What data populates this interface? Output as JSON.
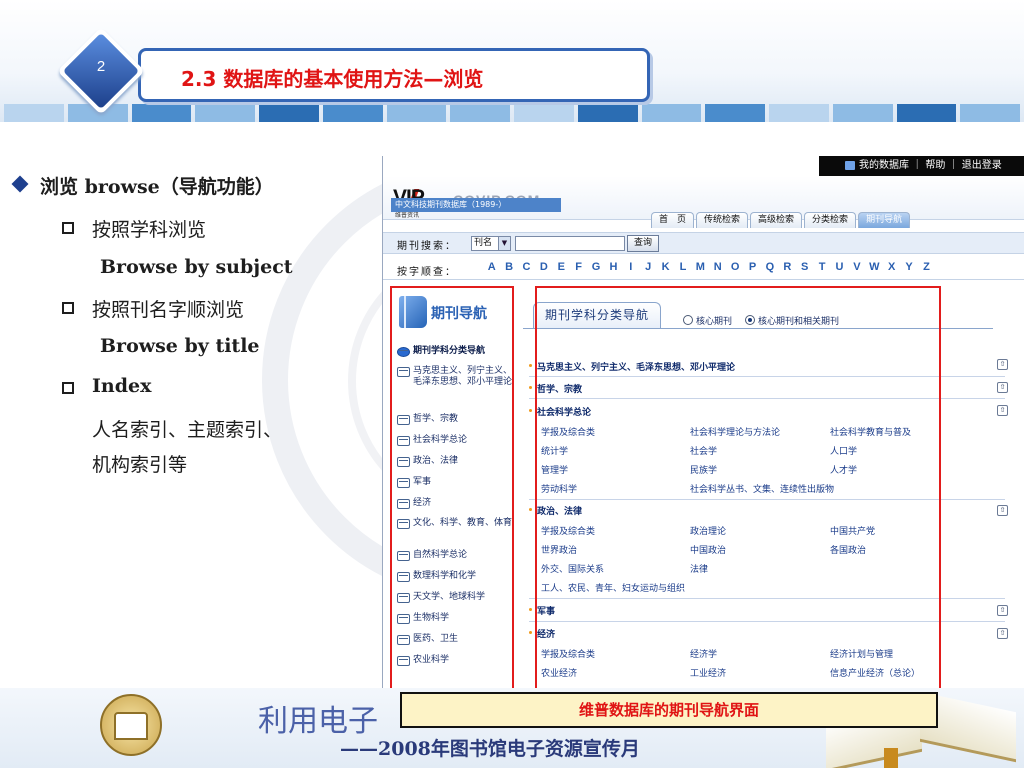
{
  "slide": {
    "number": "2",
    "title": "2.3 数据库的基本使用方法—浏览"
  },
  "bullets": {
    "main": "浏览  browse（导航功能）",
    "items": [
      {
        "label": "按照学科浏览",
        "sub": "Browse by subject"
      },
      {
        "label": "按照刊名字顺浏览",
        "sub": "Browse by title"
      },
      {
        "label": "Index",
        "sub": "人名索引、主题索引、",
        "sub2": "机构索引等"
      }
    ]
  },
  "site": {
    "topbar": "我的数据库 ｜ 帮助 ｜ 退出登录",
    "logo": {
      "vip": "VIP",
      "tagline": "维普资讯",
      "cqvip": "CQVIP.COM"
    },
    "subtitle": "中文科技期刊数据库（1989-）",
    "nav_tabs": [
      "首　页",
      "传统检索",
      "高级检索",
      "分类检索",
      "期刊导航"
    ],
    "active_tab": "期刊导航",
    "search": {
      "label": "期刊搜索：",
      "select_value": "刊名",
      "button": "查询"
    },
    "alpha": {
      "label": "按字顺查：",
      "letters": [
        "A",
        "B",
        "C",
        "D",
        "E",
        "F",
        "G",
        "H",
        "I",
        "J",
        "K",
        "L",
        "M",
        "N",
        "O",
        "P",
        "Q",
        "R",
        "S",
        "T",
        "U",
        "V",
        "W",
        "X",
        "Y",
        "Z"
      ]
    },
    "left_nav": {
      "title": "期刊导航",
      "items": [
        "期刊学科分类导航",
        "马克思主义、列宁主义、毛泽东思想、邓小平理论",
        "哲学、宗教",
        "社会科学总论",
        "政治、法律",
        "军事",
        "经济",
        "文化、科学、教育、体育",
        "自然科学总论",
        "数理科学和化学",
        "天文学、地球科学",
        "生物科学",
        "医药、卫生",
        "农业科学"
      ]
    },
    "main": {
      "tab": "期刊学科分类导航",
      "radios": [
        {
          "label": "核心期刊",
          "checked": false
        },
        {
          "label": "核心期刊和相关期刊",
          "checked": true
        }
      ],
      "categories": [
        {
          "name": "马克思主义、列宁主义、毛泽东思想、邓小平理论",
          "subs": []
        },
        {
          "name": "哲学、宗教",
          "subs": []
        },
        {
          "name": "社会科学总论",
          "subs": [
            "学报及综合类",
            "社会科学理论与方法论",
            "社会科学教育与普及",
            "统计学",
            "社会学",
            "人口学",
            "管理学",
            "民族学",
            "人才学",
            "劳动科学",
            "社会科学丛书、文集、连续性出版物"
          ]
        },
        {
          "name": "政治、法律",
          "subs": [
            "学报及综合类",
            "政治理论",
            "中国共产党",
            "世界政治",
            "中国政治",
            "各国政治",
            "外交、国际关系",
            "法律",
            "工人、农民、青年、妇女运动与组织"
          ]
        },
        {
          "name": "军事",
          "subs": []
        },
        {
          "name": "经济",
          "subs": [
            "学报及综合类",
            "经济学",
            "经济计划与管理",
            "农业经济",
            "工业经济",
            "信息产业经济（总论）"
          ]
        }
      ]
    }
  },
  "caption": "维普数据库的期刊导航界面",
  "footer": {
    "main": "利用电子",
    "sub": "——2008年图书馆电子资源宣传月"
  }
}
